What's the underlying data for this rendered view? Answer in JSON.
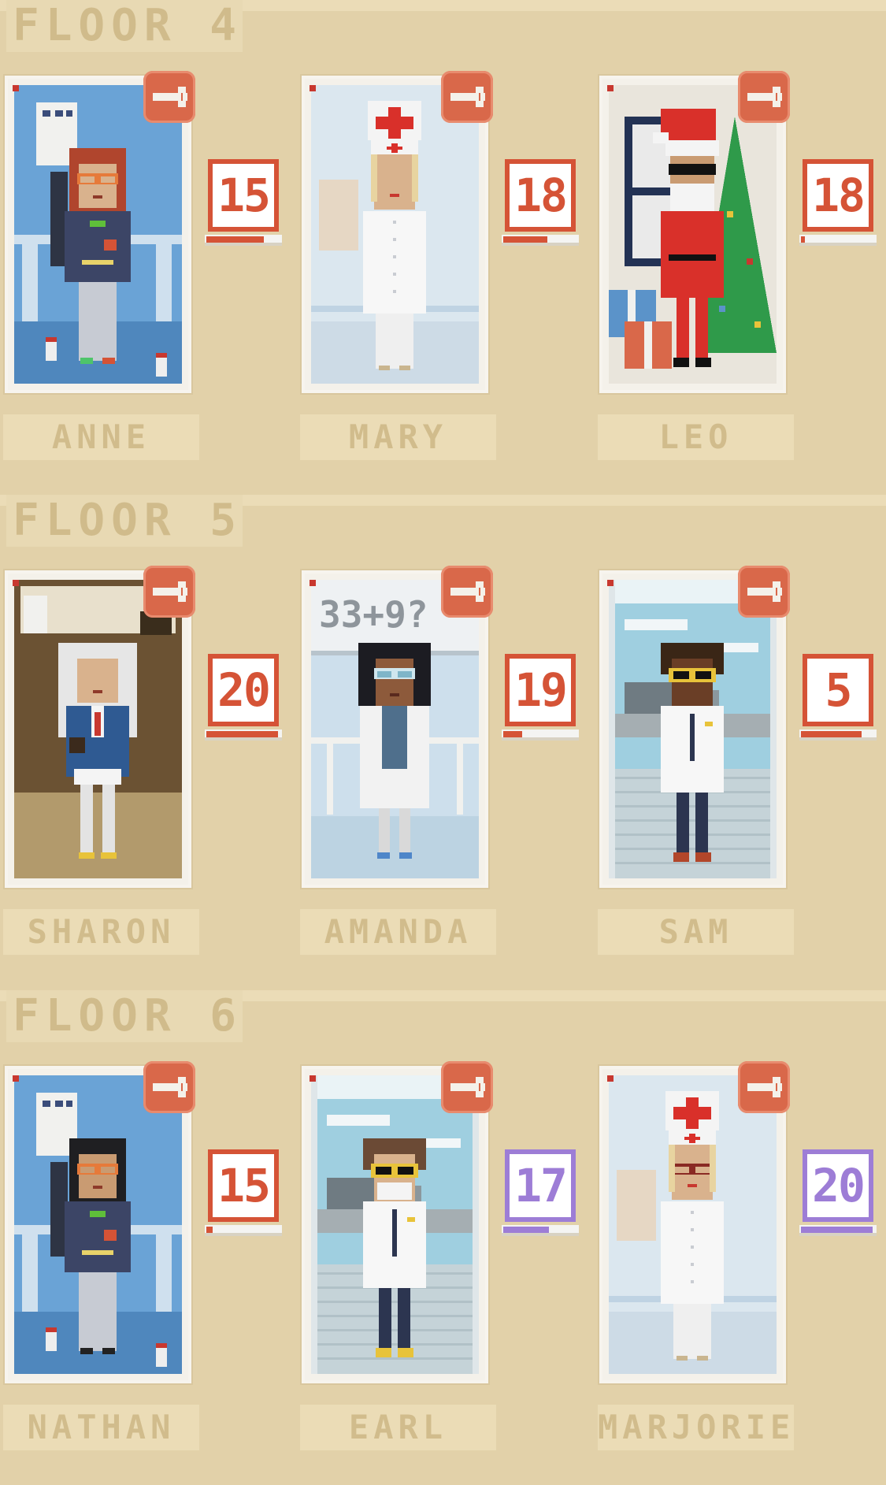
{
  "colors": {
    "background": "#e2d1a9",
    "accent_red": "#d55336",
    "accent_purple": "#9d7dd6",
    "label_text": "#d1bc8c"
  },
  "icons": {
    "repair": "wrench-icon",
    "indicator": "red-dot-icon"
  },
  "floors": [
    {
      "label": "FLOOR 4",
      "residents": [
        {
          "name": "ANNE",
          "level": "15",
          "progress": 0.78,
          "badge_color": "red",
          "scene": "clinic",
          "outfit": "sweater"
        },
        {
          "name": "MARY",
          "level": "18",
          "progress": 0.6,
          "badge_color": "red",
          "scene": "hospital",
          "outfit": "nurse"
        },
        {
          "name": "LEO",
          "level": "18",
          "progress": 0.05,
          "badge_color": "red",
          "scene": "christmas",
          "outfit": "santa"
        }
      ]
    },
    {
      "label": "FLOOR 5",
      "residents": [
        {
          "name": "SHARON",
          "level": "20",
          "progress": 0.97,
          "badge_color": "red",
          "scene": "office",
          "outfit": "suit"
        },
        {
          "name": "AMANDA",
          "level": "19",
          "progress": 0.25,
          "badge_color": "red",
          "scene": "lab",
          "outfit": "labcoat",
          "board_text": "33+9?"
        },
        {
          "name": "SAM",
          "level": "5",
          "progress": 0.82,
          "badge_color": "red",
          "scene": "airport",
          "outfit": "pilot"
        }
      ]
    },
    {
      "label": "FLOOR 6",
      "residents": [
        {
          "name": "NATHAN",
          "level": "15",
          "progress": 0.08,
          "badge_color": "red",
          "scene": "clinic",
          "outfit": "sweater"
        },
        {
          "name": "EARL",
          "level": "17",
          "progress": 0.62,
          "badge_color": "purple",
          "scene": "airport",
          "outfit": "pilot"
        },
        {
          "name": "MARJORIE",
          "level": "20",
          "progress": 0.97,
          "badge_color": "purple",
          "scene": "hospital",
          "outfit": "nurse"
        }
      ]
    }
  ]
}
